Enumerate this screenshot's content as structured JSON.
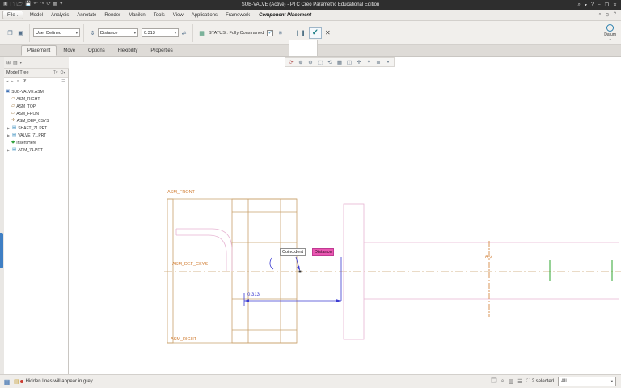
{
  "titlebar": {
    "title": "SUB-VALVE (Active) - PTC Creo Parametric Educational Edition"
  },
  "menubar": {
    "file_label": "File",
    "items": [
      "Model",
      "Analysis",
      "Annotate",
      "Render",
      "Manikin",
      "Tools",
      "View",
      "Applications",
      "Framework"
    ],
    "active": "Component Placement"
  },
  "ribbon": {
    "user_defined": "User Defined",
    "constraint": "Distance",
    "offset": "0.313",
    "status": "STATUS : Fully Constrained",
    "datum_label": "Datum"
  },
  "subtabs": {
    "items": [
      "Placement",
      "Move",
      "Options",
      "Flexibility",
      "Properties"
    ],
    "active": "Placement"
  },
  "model_tree": {
    "title": "Model Tree",
    "items": [
      {
        "label": "SUB-VALVE.ASM",
        "icon": "assembly"
      },
      {
        "label": "ASM_RIGHT",
        "icon": "datum-plane"
      },
      {
        "label": "ASM_TOP",
        "icon": "datum-plane"
      },
      {
        "label": "ASM_FRONT",
        "icon": "datum-plane"
      },
      {
        "label": "ASM_DEF_CSYS",
        "icon": "csys"
      },
      {
        "label": "SHAFT_71.PRT",
        "icon": "part"
      },
      {
        "label": "VALVE_71.PRT",
        "icon": "part"
      },
      {
        "label": "Insert Here",
        "icon": "insert-marker"
      },
      {
        "label": "ARM_71.PRT",
        "icon": "part"
      }
    ]
  },
  "graphics": {
    "labels": {
      "front": "ASM_FRONT",
      "csys": "ASM_DEF_CSYS",
      "right": "ASM_RIGHT",
      "axis": "A_2",
      "coincident": "Coincident",
      "distance": "Distance",
      "dim": "0.313"
    }
  },
  "statusbar": {
    "message": "Hidden lines will appear in grey",
    "selected": "2 selected",
    "filter": "All"
  },
  "colors": {
    "wireframe_tan": "#c9a06b",
    "wireframe_pink": "#e6b4d2",
    "datum_orange": "#cf7a2e",
    "dimension_blue": "#3b3bd1",
    "constraint_magenta": "#ea57b2",
    "highlight_green": "#2ea52e",
    "titlebar_dark": "#2e2e2e",
    "panel_gray": "#f1efec"
  }
}
